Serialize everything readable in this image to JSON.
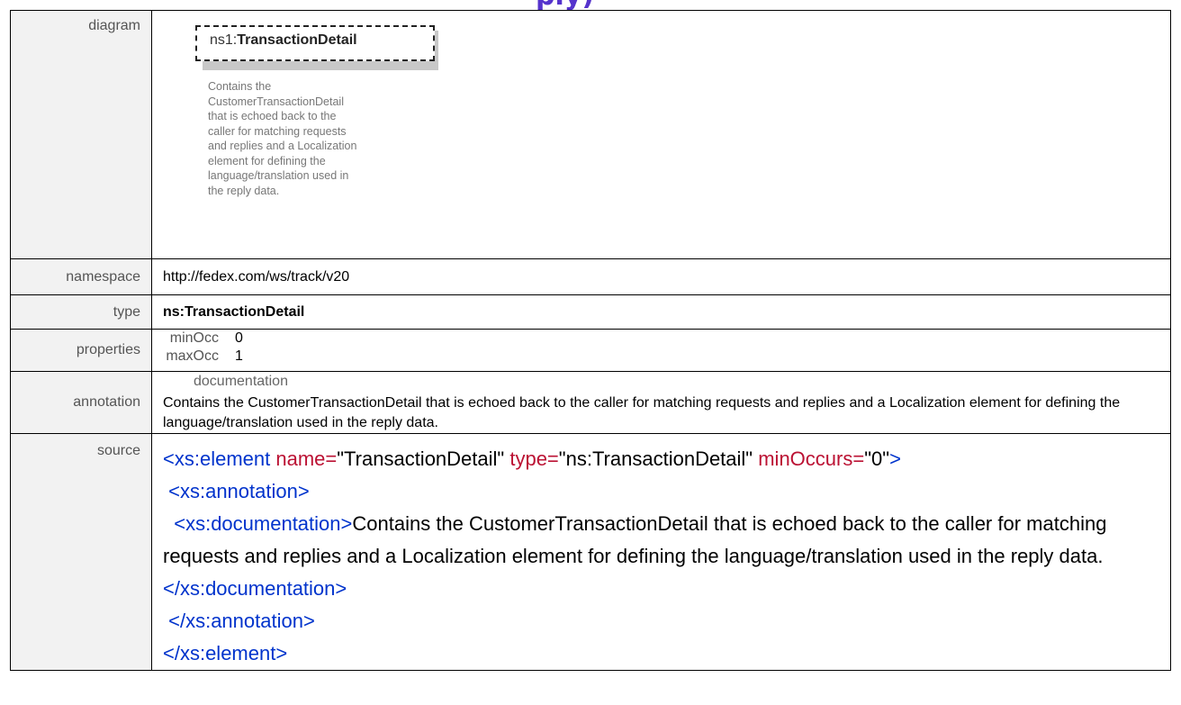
{
  "heading_fragment": "ply)",
  "rows": {
    "diagram": {
      "label": "diagram",
      "box_prefix": "ns1:",
      "box_name": "TransactionDetail",
      "doc_lines": [
        "Contains the",
        "CustomerTransactionDetail",
        "that is echoed back to the",
        "caller for matching requests",
        "and replies and a Localization",
        "element for defining the",
        "language/translation used in",
        "the reply data."
      ]
    },
    "namespace": {
      "label": "namespace",
      "value": "http://fedex.com/ws/track/v20"
    },
    "type": {
      "label": "type",
      "value": "ns:TransactionDetail"
    },
    "properties": {
      "label": "properties",
      "items": [
        {
          "key": "minOcc",
          "value": "0"
        },
        {
          "key": "maxOcc",
          "value": "1"
        }
      ]
    },
    "annotation": {
      "label": "annotation",
      "key": "documentation",
      "text": "Contains the CustomerTransactionDetail that is echoed back to the caller for matching requests and replies and a Localization  element for defining  the language/translation used in the reply data."
    },
    "source": {
      "label": "source",
      "line1_open": "<xs:element ",
      "line1_name_attr": "name=",
      "line1_name_val": "\"TransactionDetail\" ",
      "line1_type_attr": "type=",
      "line1_type_val": "\"ns:TransactionDetail\" ",
      "line1_min_attr": "minOccurs=",
      "line1_min_val": "\"0\"",
      "line1_close": ">",
      "line2": " <xs:annotation>",
      "line3_open": "  <xs:documentation>",
      "line3_text": "Contains the CustomerTransactionDetail that is echoed back to the caller for matching requests and replies and a Localization element for defining the language/translation used in the reply data.",
      "line3_close": "</xs:documentation>",
      "line4": " </xs:annotation>",
      "line5": "</xs:element>"
    }
  },
  "colors": {
    "tag": "#0033cc",
    "attribute": "#bb1133",
    "label_bg": "#f2f2f2",
    "heading": "#5533cc"
  }
}
